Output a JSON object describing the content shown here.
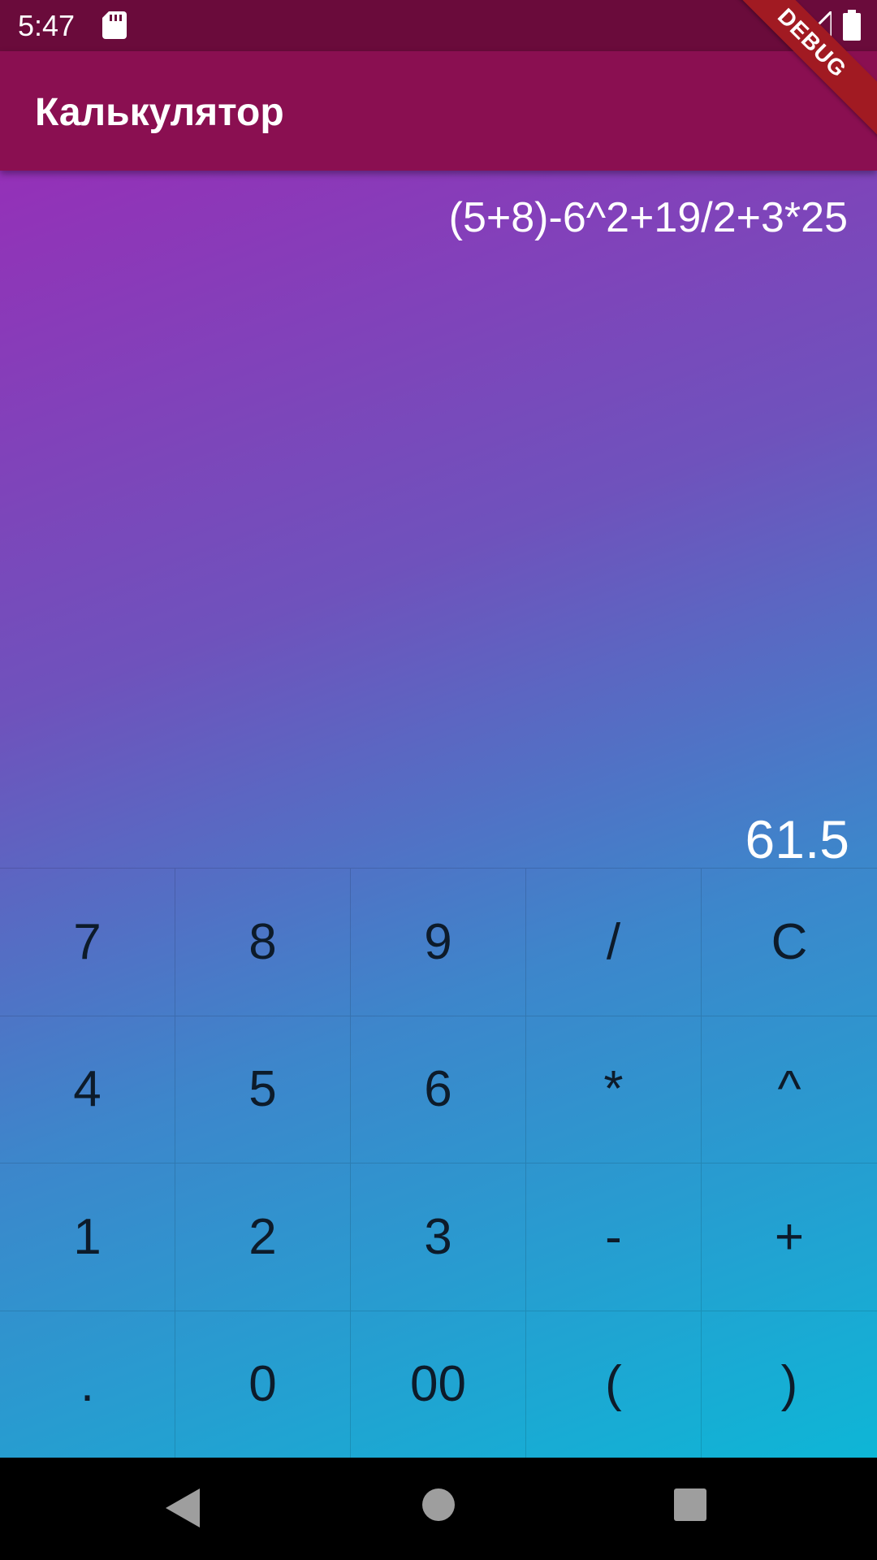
{
  "status_bar": {
    "time": "5:47",
    "icons": [
      "sd-card-icon",
      "wifi-icon",
      "signal-icon",
      "battery-icon"
    ]
  },
  "app_bar": {
    "title": "Калькулятор"
  },
  "debug_banner": "DEBUG",
  "display": {
    "expression": "(5+8)-6^2+19/2+3*25",
    "result": "61.5"
  },
  "keypad": {
    "rows": [
      [
        "7",
        "8",
        "9",
        "/",
        "C"
      ],
      [
        "4",
        "5",
        "6",
        "*",
        "^"
      ],
      [
        "1",
        "2",
        "3",
        "-",
        "+"
      ],
      [
        ".",
        "0",
        "00",
        "(",
        ")"
      ]
    ]
  },
  "nav_bar": {
    "icons": [
      "back-icon",
      "home-icon",
      "recents-icon"
    ]
  },
  "colors": {
    "status_bar": "#6a0b3b",
    "app_bar": "#8a0f51",
    "gradient_start": "#a026b6",
    "gradient_end": "#06bed8",
    "debug_banner": "#a11a22"
  }
}
